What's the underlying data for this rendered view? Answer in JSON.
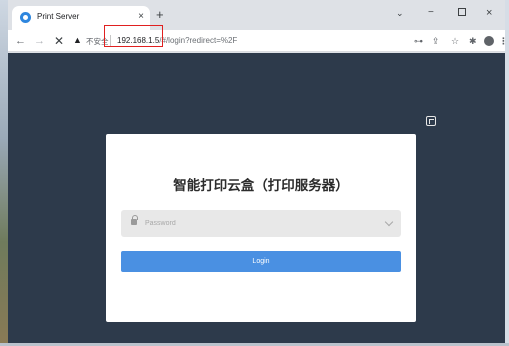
{
  "browser": {
    "tab": {
      "title": "Print Server",
      "close": "×"
    },
    "new_tab": "+",
    "window_controls": {
      "caret": "⌄",
      "minimize": "−",
      "close": "×"
    },
    "nav": {
      "back": "←",
      "forward": "→",
      "reload": "✕"
    },
    "address": {
      "security_icon": "warning-triangle-icon",
      "security_label": "不安全",
      "host": "192.168.1.5",
      "path": "/#/login?redirect=%2F"
    },
    "toolbar_icons": [
      "key-icon",
      "share-icon",
      "star-icon",
      "extensions-icon",
      "profile-icon",
      "menu-icon"
    ]
  },
  "page": {
    "background": "#2d3a4b",
    "language_icon": "translate-icon",
    "login": {
      "title": "智能打印云盒（打印服务器）",
      "password_placeholder": "Password",
      "login_button": "Login",
      "accent": "#4a90e2"
    }
  },
  "annotation": {
    "highlight_color": "#e02020",
    "highlight_target": "address.host"
  }
}
